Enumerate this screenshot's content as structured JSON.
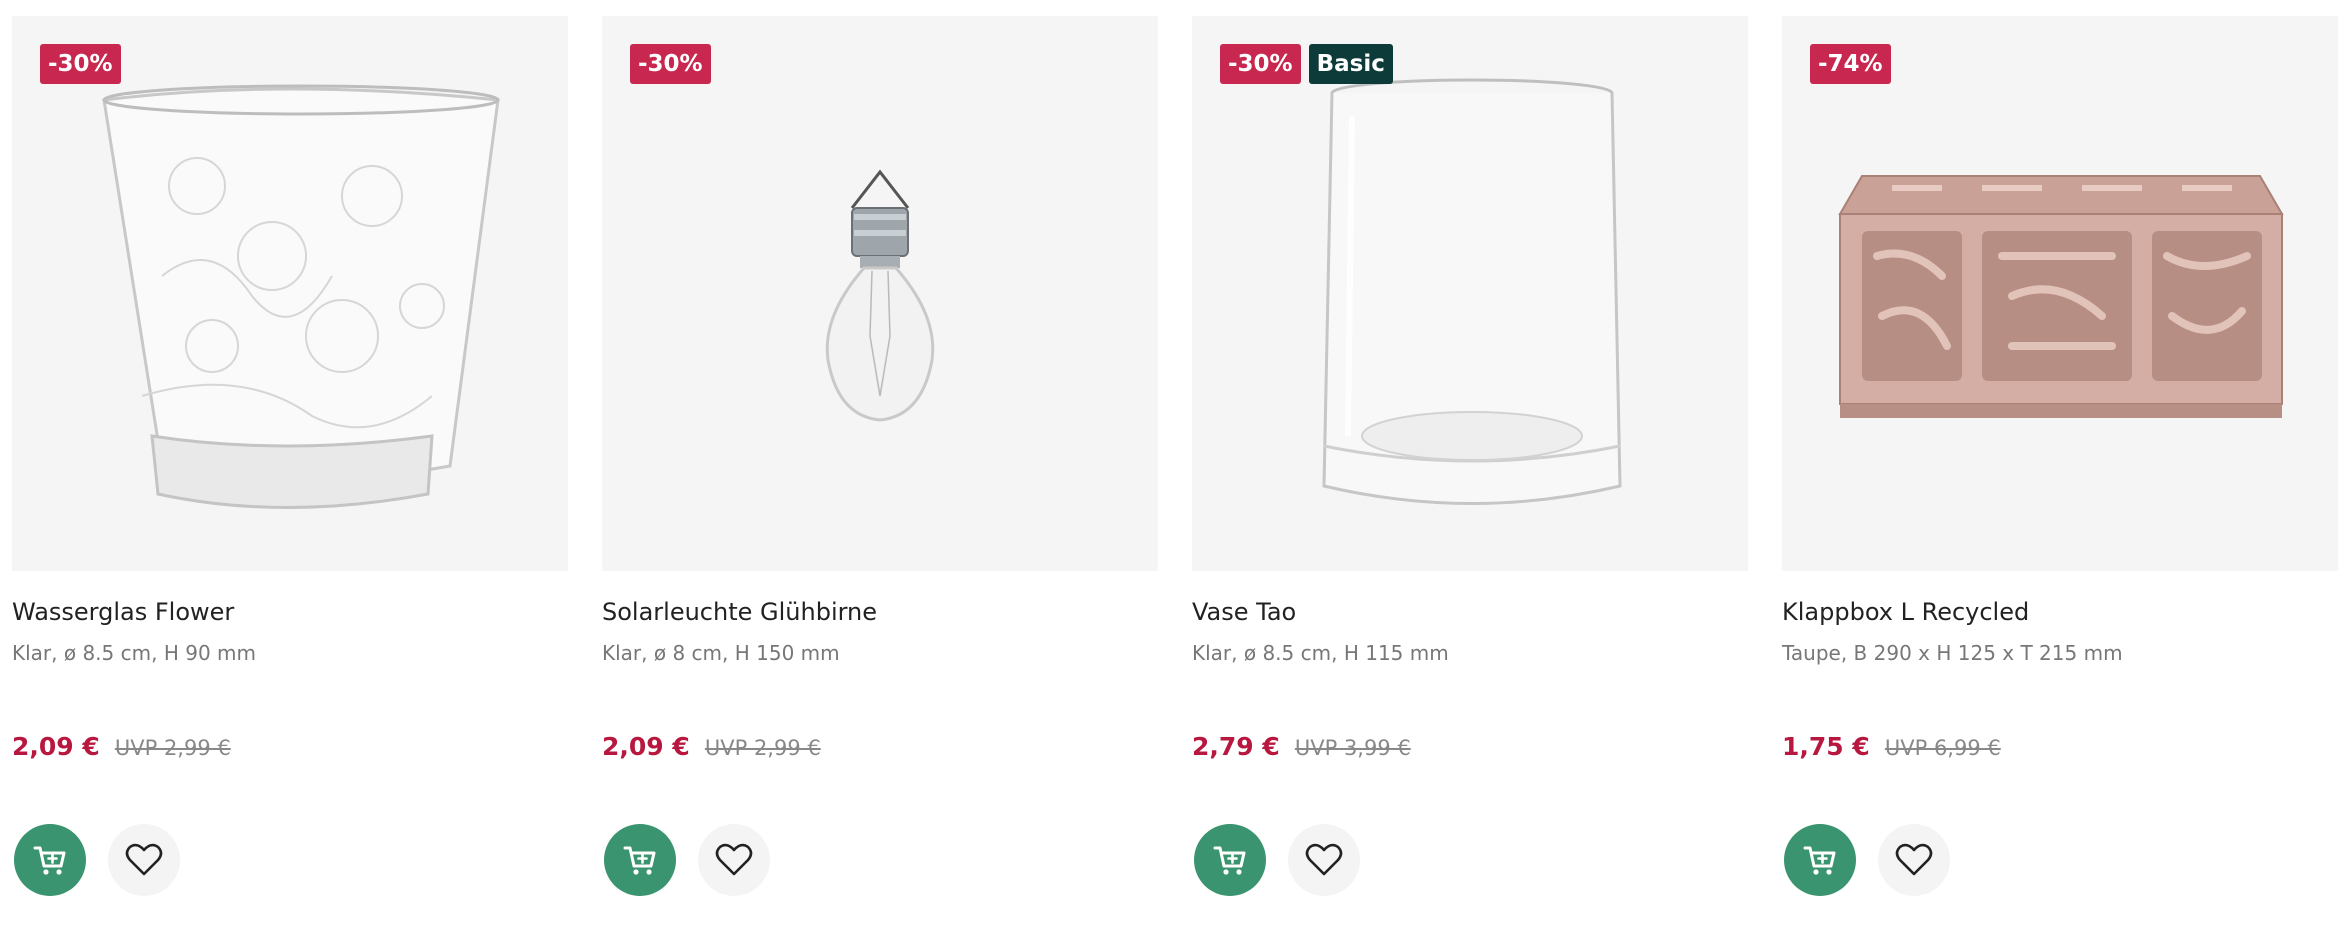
{
  "products": [
    {
      "badges": {
        "discount": "-30%"
      },
      "title": "Wasserglas Flower",
      "description": "Klar, ø 8.5 cm, H 90 mm",
      "price": "2,09 €",
      "uvp": "UVP 2,99 €",
      "image_icon": "glass-image"
    },
    {
      "badges": {
        "discount": "-30%"
      },
      "title": "Solarleuchte Glühbirne",
      "description": "Klar, ø 8 cm, H 150 mm",
      "price": "2,09 €",
      "uvp": "UVP 2,99 €",
      "image_icon": "bulb-image"
    },
    {
      "badges": {
        "discount": "-30%",
        "label": "Basic"
      },
      "title": "Vase Tao",
      "description": "Klar, ø 8.5 cm, H 115 mm",
      "price": "2,79 €",
      "uvp": "UVP 3,99 €",
      "image_icon": "vase-image"
    },
    {
      "badges": {
        "discount": "-74%"
      },
      "title": "Klappbox L Recycled",
      "description": "Taupe, B 290 x H 125 x T 215 mm",
      "price": "1,75 €",
      "uvp": "UVP 6,99 €",
      "image_icon": "crate-image"
    }
  ],
  "colors": {
    "sale_badge": "#c8284f",
    "basic_badge": "#0d3b3a",
    "price": "#b8183f",
    "cart_button": "#3a946f"
  }
}
